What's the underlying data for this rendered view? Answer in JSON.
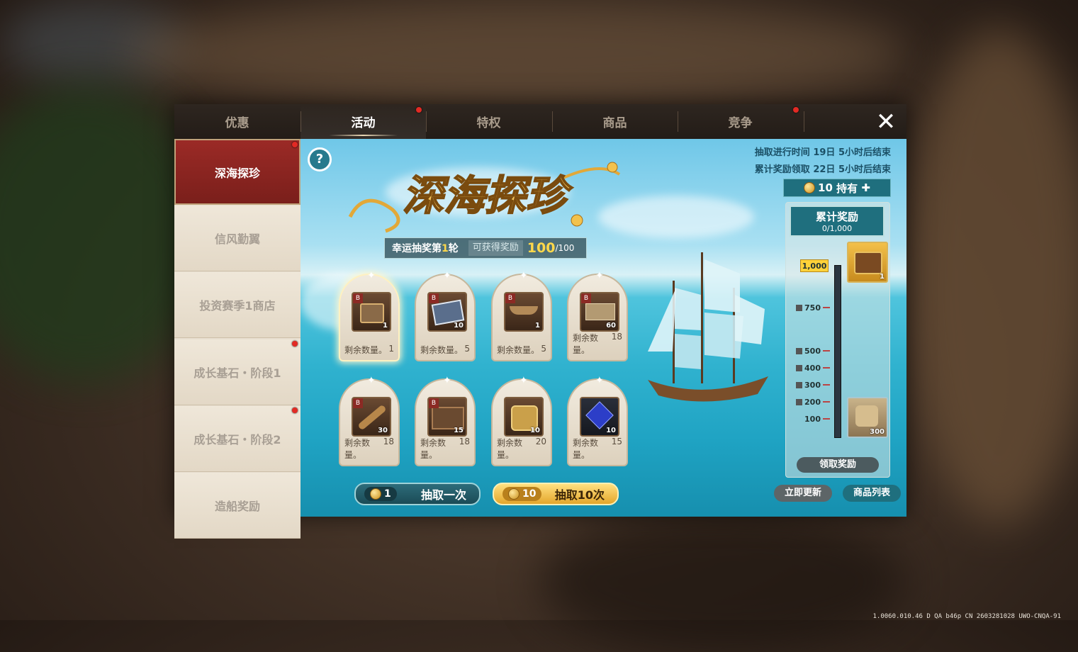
{
  "version": "1.0060.010.46 D QA b46p CN 2603281028 UWO-CNQA-91",
  "tabs": [
    {
      "label": "优惠",
      "active": false,
      "dot": false
    },
    {
      "label": "活动",
      "active": true,
      "dot": true
    },
    {
      "label": "特权",
      "active": false,
      "dot": false
    },
    {
      "label": "商品",
      "active": false,
      "dot": false
    },
    {
      "label": "竞争",
      "active": false,
      "dot": true
    }
  ],
  "close_icon": "close-icon",
  "sidebar": [
    {
      "label": "深海探珍",
      "active": true,
      "dot": true
    },
    {
      "label": "信风勤翼",
      "active": false,
      "dot": false
    },
    {
      "label": "投资赛季1商店",
      "active": false,
      "dot": false
    },
    {
      "label": "成长基石・阶段1",
      "active": false,
      "dot": true
    },
    {
      "label": "成长基石・阶段2",
      "active": false,
      "dot": true
    },
    {
      "label": "造船奖励",
      "active": false,
      "dot": false
    }
  ],
  "event": {
    "help": "?",
    "logo_title": "深海探珍",
    "round_label": "幸运抽奖第",
    "round_num": "1",
    "round_suffix": "轮",
    "reward_caption": "可获得奖励",
    "reward_value": "100",
    "reward_max": "/100",
    "timer1": "抽取进行时间 19日 5小时后结束",
    "timer2": "累计奖励领取 22日 5小时后结束",
    "hold_count": "10",
    "hold_label": "持有",
    "hold_plus": "✚"
  },
  "remaining_label": "剩余数量。",
  "items": [
    {
      "name": "chest",
      "count": "1",
      "remaining": "1",
      "color": "#8a6a48"
    },
    {
      "name": "blueprint",
      "count": "10",
      "remaining": "5",
      "color": "#5a6e8c"
    },
    {
      "name": "ship-part",
      "count": "1",
      "remaining": "5",
      "color": "#7a5a38"
    },
    {
      "name": "planks",
      "count": "60",
      "remaining": "18",
      "color": "#b39a72"
    },
    {
      "name": "telescope",
      "count": "30",
      "remaining": "18",
      "color": "#b7874a"
    },
    {
      "name": "crate",
      "count": "15",
      "remaining": "18",
      "color": "#6a4a30"
    },
    {
      "name": "scroll",
      "count": "10",
      "remaining": "20",
      "color": "#caa04a"
    },
    {
      "name": "sapphire",
      "count": "10",
      "remaining": "15",
      "color": "#2c3ec8"
    }
  ],
  "accumulate": {
    "title": "累计奖励",
    "progress": "0/1,000",
    "milestones": [
      "1,000",
      "750",
      "500",
      "400",
      "300",
      "200",
      "100"
    ],
    "top_prize_count": "1",
    "bottom_prize_count": "300",
    "claim_label": "领取奖励"
  },
  "buttons": {
    "draw1_cost": "1",
    "draw1_label": "抽取一次",
    "draw10_cost": "10",
    "draw10_label": "抽取10次",
    "refresh_label": "立即更新",
    "list_label": "商品列表"
  },
  "colors": {
    "active_tab_dot": "#e22a24",
    "sidebar_active": "#8b2723",
    "teal": "#1f6f7e",
    "gold": "#ffd84a"
  }
}
